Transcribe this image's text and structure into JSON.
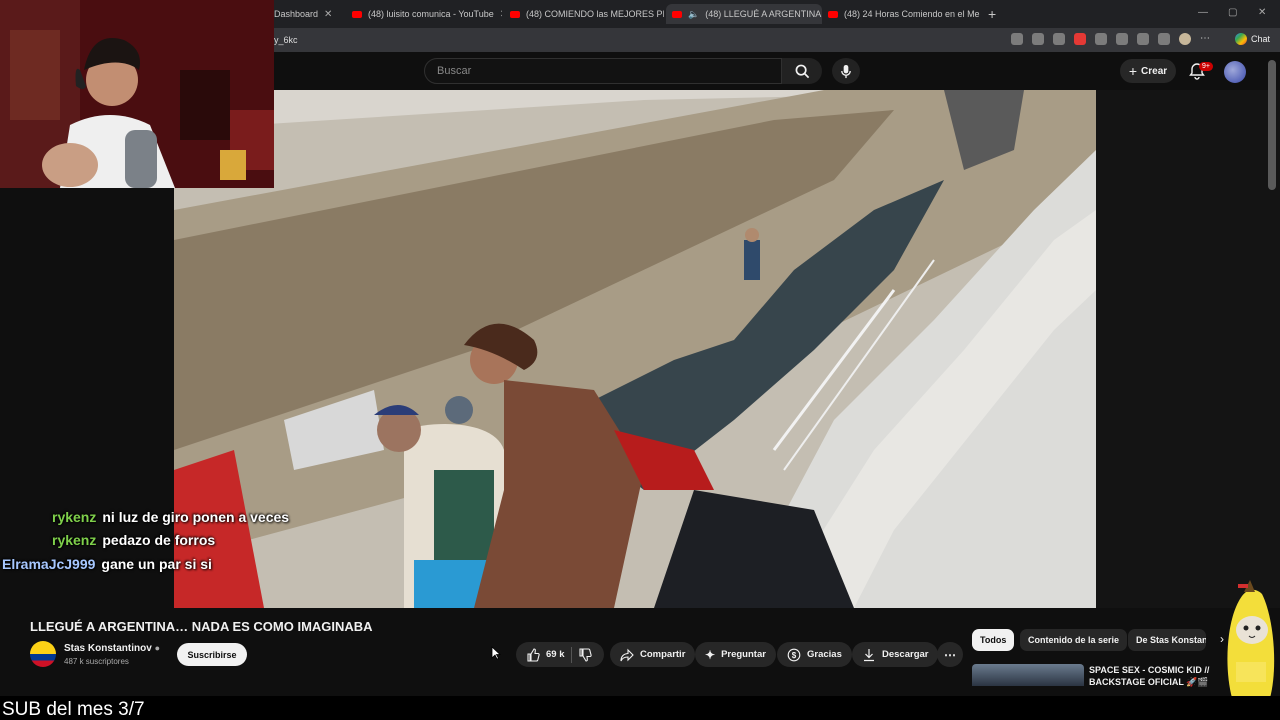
{
  "browser": {
    "tabs": [
      {
        "label": "Dashboard",
        "active": false
      },
      {
        "label": "(48) luisito comunica - YouTube",
        "active": false
      },
      {
        "label": "(48) COMIENDO las MEJORES PIZ",
        "active": false
      },
      {
        "label": "(48) LLEGUÉ A ARGENTINA...",
        "active": true
      },
      {
        "label": "(48) 24 Horas Comiendo en el Me",
        "active": false
      }
    ],
    "url": "y_6kc",
    "chat_label": "Chat"
  },
  "youtube": {
    "search_placeholder": "Buscar",
    "create_label": "Crear",
    "notif_badge": "9+",
    "video": {
      "title": "LLEGUÉ A ARGENTINA… NADA ES COMO IMAGINABA",
      "channel": "Stas Konstantinov",
      "subscribers": "487 k suscriptores",
      "subscribe_label": "Suscribirse",
      "likes": "69 k",
      "share_label": "Compartir",
      "ask_label": "Preguntar",
      "thanks_label": "Gracias",
      "download_label": "Descargar"
    },
    "chips": [
      "Todos",
      "Contenido de la serie",
      "De Stas Konstan"
    ],
    "recommended": [
      {
        "title": "SPACE SEX - COSMIC KID // BACKSTAGE OFICIAL 🚀🎬"
      }
    ]
  },
  "chat": [
    {
      "user": "rykenz",
      "message": "ni luz de giro ponen a veces",
      "color": "#7fd04b"
    },
    {
      "user": "rykenz",
      "message": "pedazo de forros",
      "color": "#7fd04b"
    },
    {
      "user": "ElramaJcJ999",
      "message": "gane un par si si",
      "color": "#a6c7ff"
    }
  ],
  "bottom_bar": {
    "text": "SUB del mes 3/7"
  }
}
